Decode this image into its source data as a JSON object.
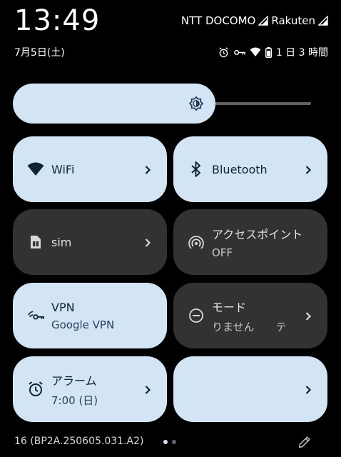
{
  "status_bar": {
    "time": "13:49",
    "date": "7月5日(土)",
    "carrier_1": "NTT DOCOMO",
    "carrier_2": "Rakuten",
    "battery_text": "1 日 3 時間"
  },
  "brightness": {
    "level": 0.68
  },
  "tiles": [
    {
      "title": "WiFi",
      "subtitle": "",
      "state": "on",
      "icon": "wifi-icon",
      "chevron": true
    },
    {
      "title": "Bluetooth",
      "subtitle": "",
      "state": "on",
      "icon": "bluetooth-icon",
      "chevron": true
    },
    {
      "title": "sim",
      "subtitle": "",
      "state": "off",
      "icon": "sim-icon",
      "chevron": true
    },
    {
      "title": "アクセスポイント",
      "subtitle": "OFF",
      "state": "off",
      "icon": "hotspot-icon",
      "chevron": false
    },
    {
      "title": "VPN",
      "subtitle": "Google VPN",
      "state": "on",
      "icon": "vpn-key-icon",
      "chevron": false
    },
    {
      "title": "モード",
      "subtitle": "りません　　テ",
      "state": "off",
      "icon": "do-not-disturb-icon",
      "chevron": true
    },
    {
      "title": "アラーム",
      "subtitle": "7:00 (日)",
      "state": "on",
      "icon": "alarm-icon",
      "chevron": true
    },
    {
      "title": "",
      "subtitle": "",
      "state": "on",
      "icon": "",
      "chevron": true
    }
  ],
  "footer": {
    "build": "16 (BP2A.250605.031.A2)",
    "page_count": 2,
    "current_page": 1
  },
  "colors": {
    "tile_on": "#d3e5f5",
    "tile_off": "#303234",
    "text_on": "#0d2434",
    "background": "#000000"
  }
}
